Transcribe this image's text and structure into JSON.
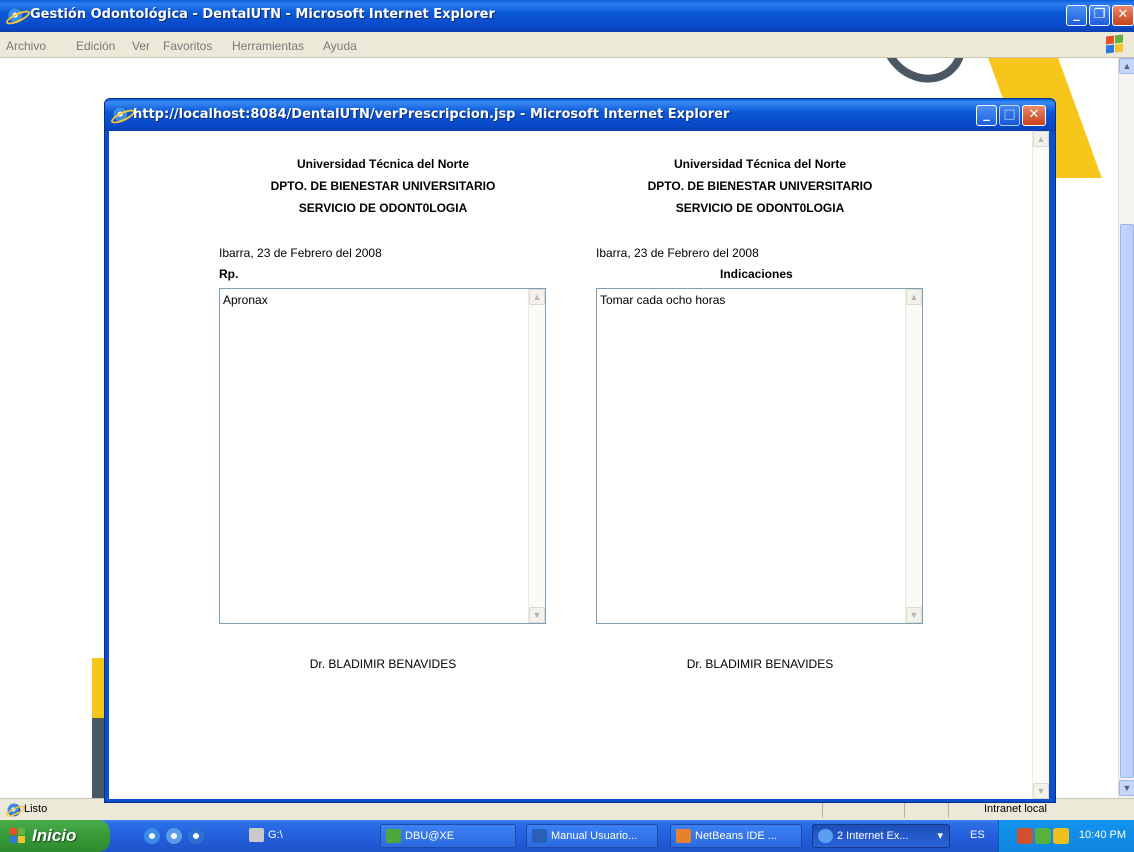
{
  "outer_window": {
    "title": "Gestión Odontológica - DentalUTN - Microsoft Internet Explorer",
    "menus": [
      "Archivo",
      "Edición",
      "Ver",
      "Favoritos",
      "Herramientas",
      "Ayuda"
    ],
    "status": "Listo",
    "zone": "Intranet local"
  },
  "popup": {
    "title": "http://localhost:8084/DentalUTN/verPrescripcion.jsp - Microsoft Internet Explorer",
    "left": {
      "header1": "Universidad Técnica del Norte",
      "header2": "DPTO. DE BIENESTAR UNIVERSITARIO",
      "header3": "SERVICIO DE ODONT0LOGIA",
      "date": "Ibarra, 23 de Febrero del 2008",
      "label": "Rp.",
      "text": "Apronax",
      "doctor": "Dr. BLADIMIR BENAVIDES"
    },
    "right": {
      "header1": "Universidad Técnica del Norte",
      "header2": "DPTO. DE BIENESTAR UNIVERSITARIO",
      "header3": "SERVICIO DE ODONT0LOGIA",
      "date": "Ibarra, 23 de Febrero del 2008",
      "label": "Indicaciones",
      "text": "Tomar cada ocho horas",
      "doctor": "Dr. BLADIMIR BENAVIDES"
    }
  },
  "taskbar": {
    "start": "Inicio",
    "drive": "G:\\",
    "buttons": [
      "DBU@XE",
      "Manual Usuario...",
      "NetBeans IDE ...",
      "2 Internet Ex..."
    ],
    "language": "ES",
    "clock": "10:40 PM"
  },
  "icons": [
    "ie-icon",
    "windows-logo-icon",
    "minimize-icon",
    "maximize-icon",
    "close-icon",
    "scroll-up-icon",
    "scroll-down-icon",
    "start-flag-icon",
    "clock-icon"
  ],
  "colors": {
    "titlebar": "#0b59d6",
    "start": "#3a9c3a",
    "tray": "#1294f0",
    "brand_yellow": "#f7c61a"
  }
}
